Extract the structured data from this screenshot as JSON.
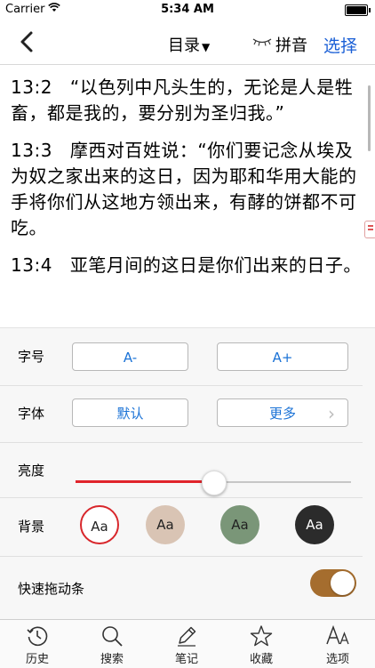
{
  "status": {
    "carrier": "Carrier",
    "time": "5:34 AM"
  },
  "nav": {
    "toc_label": "目录",
    "pinyin_label": "拼音",
    "select_label": "选择"
  },
  "verses": [
    {
      "num": "13:2",
      "text": "“以色列中凡头生的，无论是人是牲畜，都是我的，要分别为圣归我。”"
    },
    {
      "num": "13:3",
      "text": "摩西对百姓说：“你们要记念从埃及为奴之家出来的这日，因为耶和华用大能的手将你们从这地方领出来，有酵的饼都不可吃。"
    },
    {
      "num": "13:4",
      "text": "亚笔月间的这日是你们出来的日子。"
    }
  ],
  "settings": {
    "font_size_label": "字号",
    "font_smaller": "A-",
    "font_larger": "A+",
    "font_label": "字体",
    "font_default": "默认",
    "font_more": "更多",
    "brightness_label": "亮度",
    "brightness_level": 0.5,
    "background_label": "背景",
    "backgrounds": [
      {
        "text": "Aa",
        "color": "#ffffff",
        "text_color": "#222222",
        "selected": true
      },
      {
        "text": "Aa",
        "color": "#d9c4b4",
        "text_color": "#222222",
        "selected": false
      },
      {
        "text": "Aa",
        "color": "#7a9678",
        "text_color": "#222222",
        "selected": false
      },
      {
        "text": "Aa",
        "color": "#2b2b2b",
        "text_color": "#ffffff",
        "selected": false
      }
    ],
    "fast_scroll_label": "快速拖动条",
    "fast_scroll_on": true
  },
  "tabs": [
    {
      "label": "历史",
      "icon": "history-icon"
    },
    {
      "label": "搜索",
      "icon": "search-icon"
    },
    {
      "label": "笔记",
      "icon": "pencil-icon"
    },
    {
      "label": "收藏",
      "icon": "star-icon"
    },
    {
      "label": "选项",
      "icon": "font-options-icon"
    }
  ],
  "colors": {
    "accent": "#1a72d6",
    "slider_fill": "#e0242b",
    "toggle_on": "#a56d2e"
  }
}
